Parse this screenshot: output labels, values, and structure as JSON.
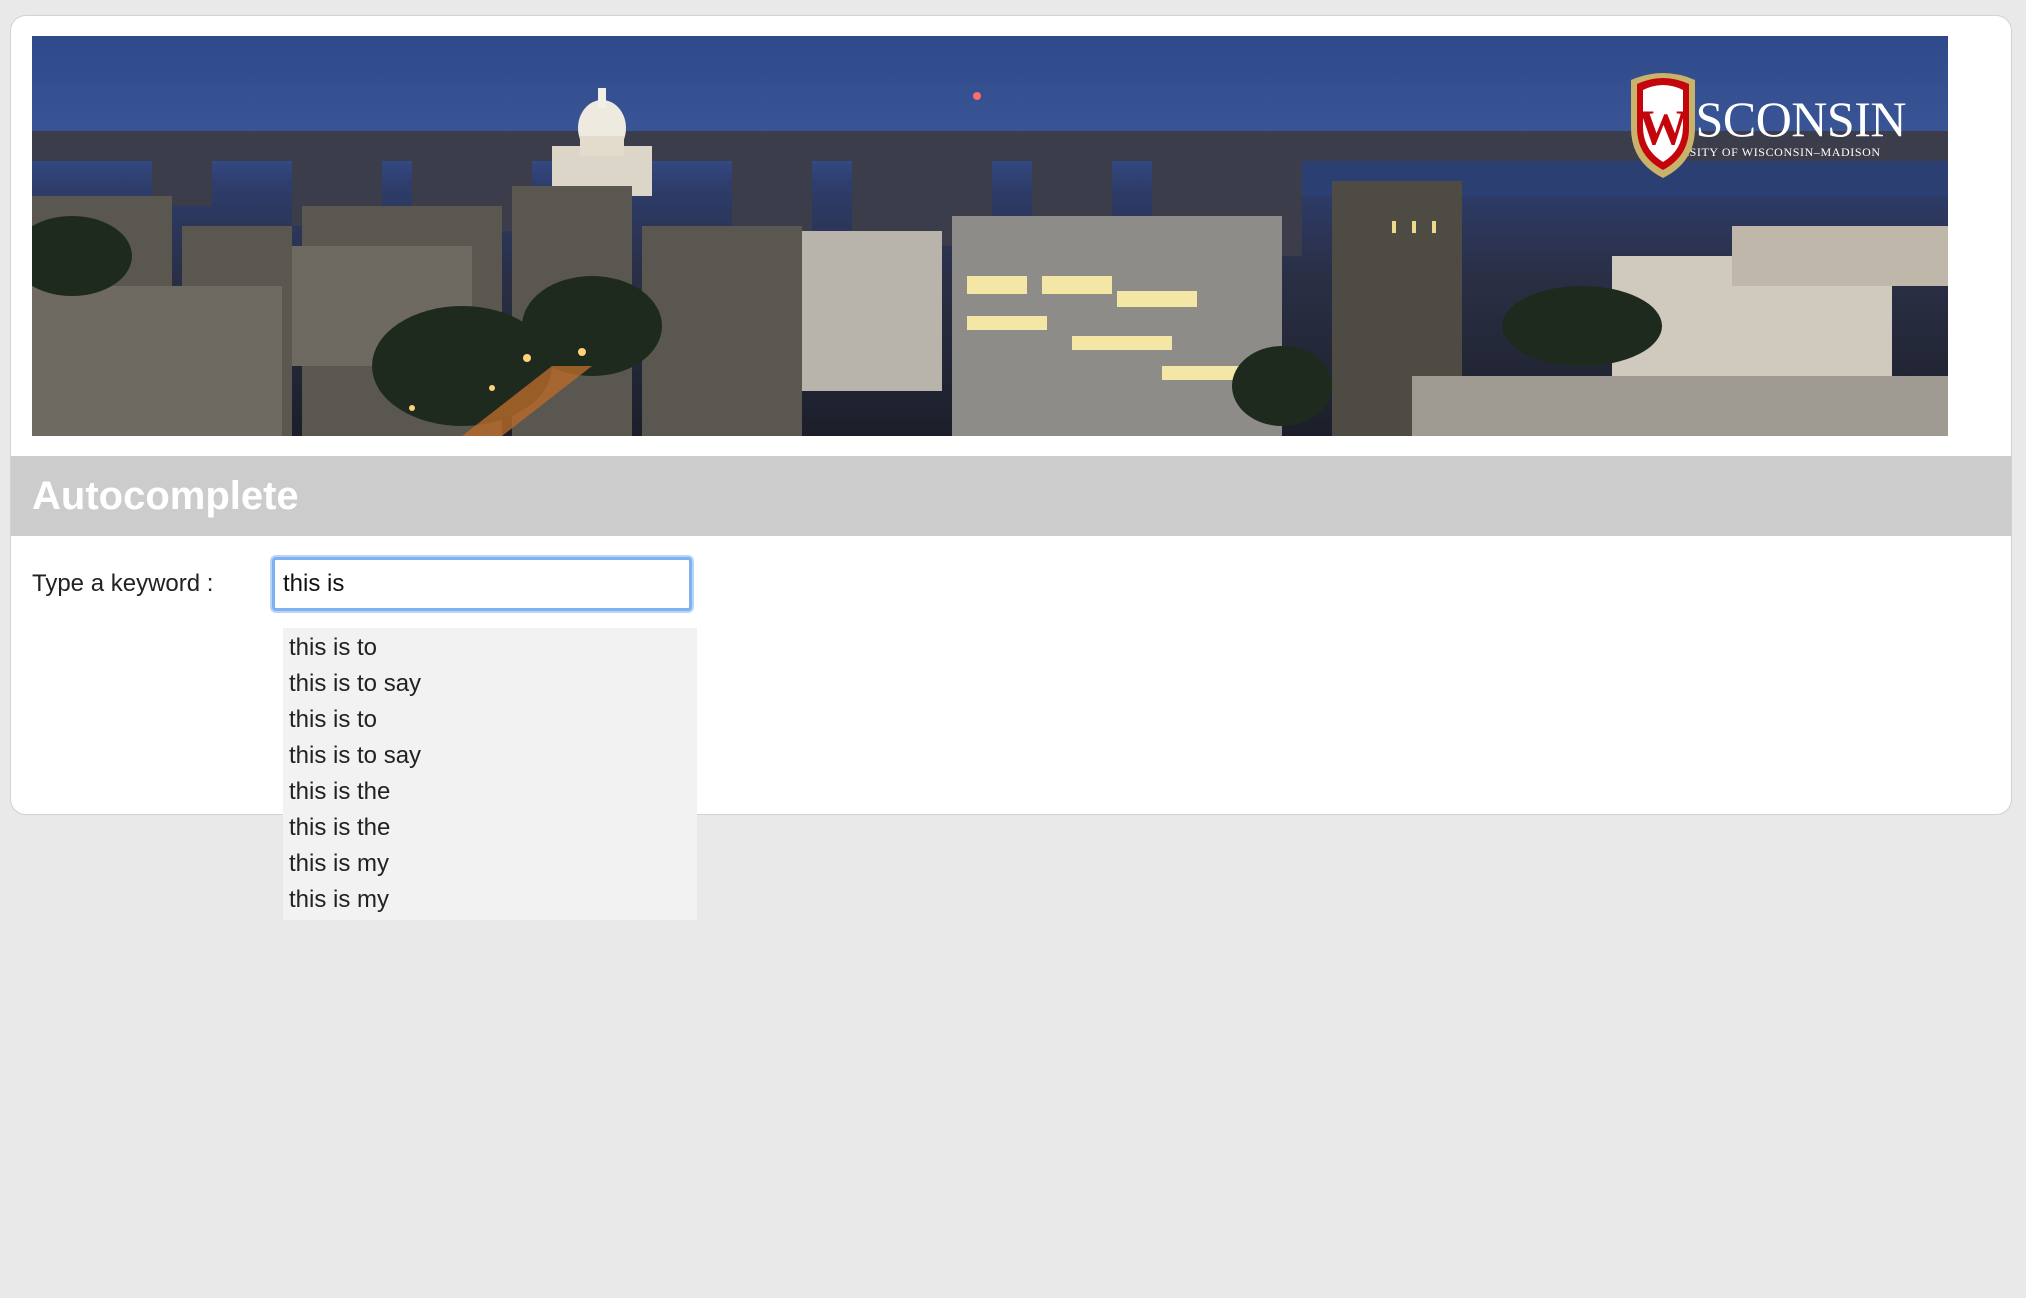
{
  "banner": {
    "logo_word": "WISCONSIN",
    "logo_sub": "UNIVERSITY OF WISCONSIN–MADISON",
    "logo_crest_letter": "W",
    "crest_color": "#c5050c"
  },
  "page": {
    "title": "Autocomplete"
  },
  "form": {
    "label": "Type a keyword :",
    "input_value": "this is"
  },
  "suggestions": [
    "this is to",
    "this is to say",
    "this is to",
    "this is to say",
    "this is the",
    "this is the",
    "this is my",
    "this is my"
  ],
  "colors": {
    "page_bg": "#e9e9e9",
    "titlebar_bg": "#cccccc",
    "dropdown_bg": "#f2f2f2",
    "focus_ring": "#7fb1f0"
  }
}
